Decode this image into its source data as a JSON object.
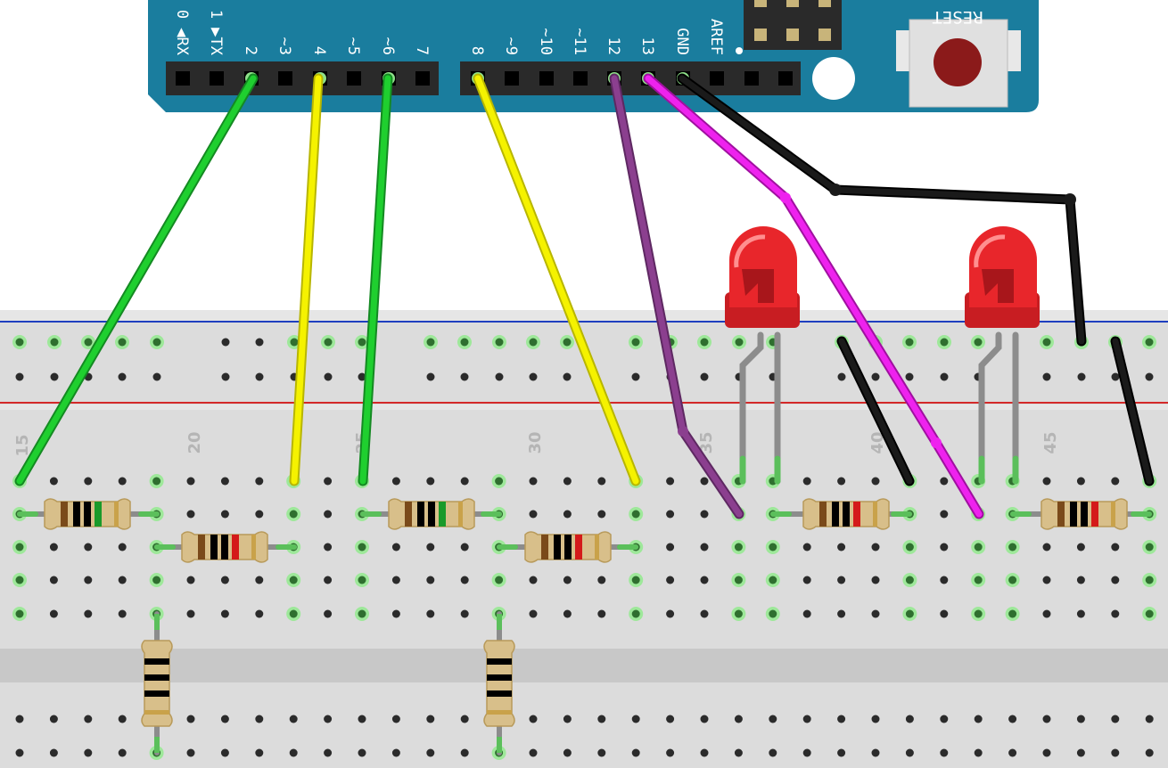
{
  "colors": {
    "board": "#1a7d9e",
    "board_edge": "#166d8a",
    "breadboard": "#d9d9d9",
    "breadboard_gap": "#c9c9c9",
    "rail_blue": "#1f3fbf",
    "rail_red": "#d42a2a",
    "hole": "#2b2b2b",
    "hole_active": "#8fe08a",
    "wire_green": "#1fbf2f",
    "wire_yellow": "#f2ef00",
    "wire_purple": "#8b3f8f",
    "wire_magenta": "#e61ee6",
    "wire_black": "#111111",
    "led_red": "#e8262b",
    "resistor_body": "#d8bf8a",
    "reset_button": "#8b1a1a"
  },
  "arduino": {
    "pin_labels_left": [
      "0 ◀RX",
      "1 ▶TX",
      "2",
      "~3",
      "4",
      "~5",
      "~6",
      "7"
    ],
    "pin_labels_right": [
      "8",
      "~9",
      "~10",
      "~11",
      "12",
      "13",
      "GND",
      "AREF"
    ],
    "reset_label": "RESET"
  },
  "breadboard": {
    "column_numbers": [
      "15",
      "20",
      "25",
      "30",
      "35",
      "40",
      "45"
    ]
  },
  "components": {
    "resistors": 8,
    "leds": 2,
    "wires": [
      "green",
      "yellow",
      "green",
      "yellow",
      "purple",
      "magenta",
      "black",
      "black",
      "black"
    ]
  }
}
